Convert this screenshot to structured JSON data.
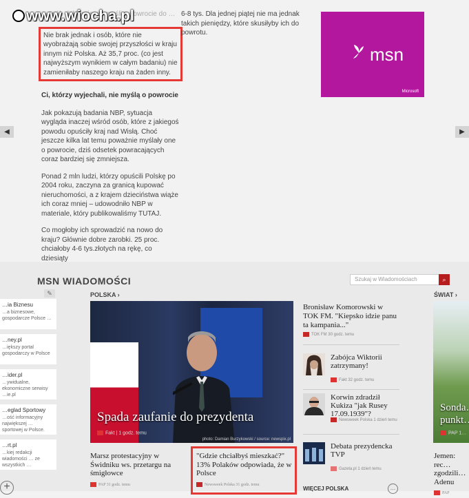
{
  "watermark": "www.wiocha.pl",
  "article": {
    "fade_text": "…osób deklaruje, że myśli o powrocie do …",
    "highlight": "Nie brak jednak i osób, które nie wyobrażają sobie swojej przyszłości w kraju innym niż Polska. Aż 35,7 proc. (co jest najwyższym wynikiem w całym badaniu) nie zamieniłaby naszego kraju na żaden inny.",
    "subheading": "Ci, którzy wyjechali, nie myślą o powrocie",
    "para1": "Jak pokazują badania NBP, sytuacja wygląda inaczej wśród osób, które z jakiegoś powodu opuściły kraj nad Wisłą. Choć jeszcze kilka lat temu poważnie myślały one o powrocie, dziś odsetek powracających coraz bardziej się zmniejsza.",
    "para2": "Ponad 2 mln ludzi, którzy opuścili Polskę po 2004 roku, zaczyna za granicą kupować nieruchomości, a z krajem dzieciństwa wiąże ich coraz mniej – udowodniło NBP w materiale, który publikowaliśmy TUTAJ.",
    "para3": "Co mogłoby ich sprowadzić na nowo do kraju? Głównie dobre zarobki. 25 proc. chciałoby 4-6 tys.złotych na rękę, co dziesiąty",
    "col2_text": "6-8 tys. Dla jednej piątej nie ma jednak takich pieniędzy, które skusiłyby ich do powrotu."
  },
  "ad": {
    "brand": "msn",
    "sponsor": "Microsoft",
    "color": "#b3179e"
  },
  "nav": {
    "prev": "◀",
    "next": "▶"
  },
  "msn": {
    "title": "MSN WIADOMOŚCI",
    "search_placeholder": "Szukaj w Wiadomościach",
    "search_icon": "⌕",
    "edit_icon": "✎",
    "section_polska": "POLSKA ›",
    "section_swiat": "ŚWIAT ›",
    "left_cards": [
      {
        "title": "…ia Biznesu",
        "desc": "…a biznesowe, gospodarcze Polsce …"
      },
      {
        "title": "…ney.pl",
        "desc": "…iększy portal gospodarczy w Polsce"
      },
      {
        "title": "…ider.pl",
        "desc": "…ywidualne, ekonomiczne serwisy …ie.pl"
      },
      {
        "title": "…eglad Sportowy",
        "desc": "…ość informacyjny największej … sportowej w Polsce."
      },
      {
        "title": "…rt.pl",
        "desc": "…kiej redakcji wiadomości … ze wszystkich …"
      }
    ],
    "add_icon": "+",
    "hero": {
      "caption": "Spada zaufanie do prezydenta",
      "source": "Fakt",
      "time": "1 godz. temu",
      "credit": "photo: Damian Burzykowski / source: newspix.pl"
    },
    "side": [
      {
        "title": "Bronisław Komorowski w TOK FM. \"Kiepsko idzie panu ta kampania...\"",
        "source": "TOK FM",
        "time": "30 godz. temu"
      },
      {
        "title": "Zabójca Wiktorii zatrzymany!",
        "source": "Fakt",
        "time": "32 godz. temu"
      },
      {
        "title": "Korwin zdradził Kukiza \"jak Rusey 17.09.1939\"?",
        "source": "Newsweek Polska",
        "time": "1 dzień temu"
      },
      {
        "title": "Debata prezydencka TVP",
        "source": "Gazeta.pl",
        "time": "1 dzień temu"
      }
    ],
    "world": {
      "caption": "Sonda… punkt…",
      "source": "PAP",
      "time": "1…"
    },
    "bottom": [
      {
        "title": "Marsz protestacyjny w Świdniku ws. przetargu na śmigłowce",
        "source": "PAP",
        "time": "31 godz. temu"
      },
      {
        "title": "\"Gdzie chciałbyś mieszkać?\" 13% Polaków odpowiada, że w Polsce",
        "source": "Newsweek Polska",
        "time": "31 godz. temu"
      },
      {
        "title": "Jemen: rec… zgodzili… Adenu",
        "source": "PAP",
        "time": ""
      }
    ],
    "more": "WIĘCEJ POLSKA",
    "more_icon": "…"
  }
}
